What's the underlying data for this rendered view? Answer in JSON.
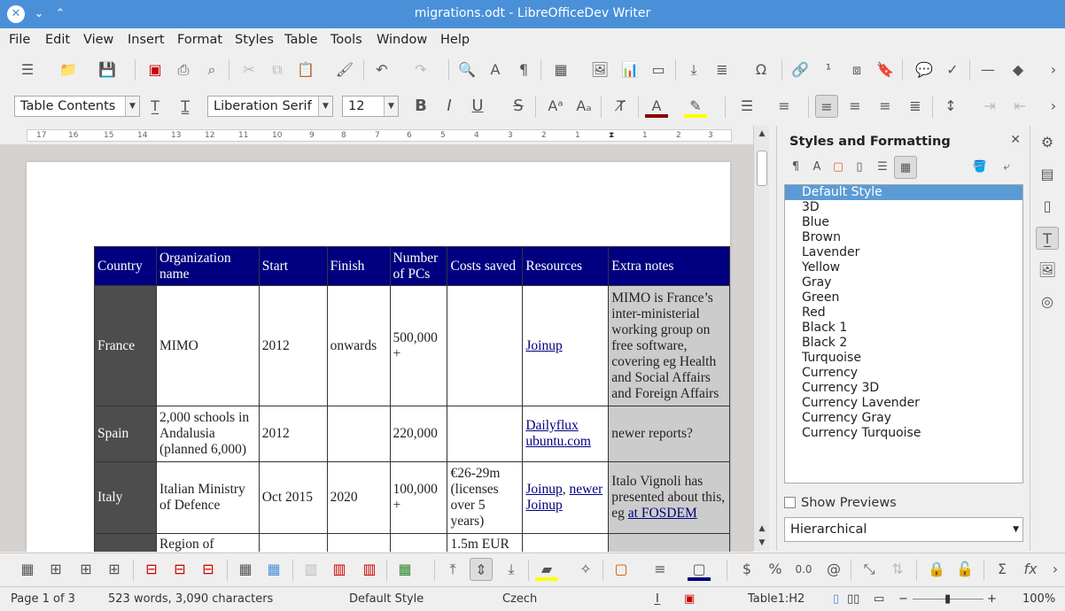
{
  "window": {
    "title": "migrations.odt - LibreOfficeDev Writer"
  },
  "menu": [
    "File",
    "Edit",
    "View",
    "Insert",
    "Format",
    "Styles",
    "Table",
    "Tools",
    "Window",
    "Help"
  ],
  "formatting": {
    "paragraph_style": "Table Contents",
    "font_name": "Liberation Serif",
    "font_size": "12"
  },
  "table": {
    "headers": [
      "Country",
      "Organization name",
      "Start",
      "Finish",
      "Number of PCs",
      "Costs saved",
      "Resources",
      "Extra notes"
    ],
    "rows": [
      {
        "country": "France",
        "org": "MIMO",
        "start": "2012",
        "finish": "onwards",
        "pcs": "500,000 +",
        "costs": "",
        "resources": [
          "Joinup"
        ],
        "notes": "MIMO is France’s inter-ministerial working group on free software, covering eg Health and Social Affairs and Foreign Affairs"
      },
      {
        "country": "Spain",
        "org": "2,000 schools in Andalusia (planned 6,000)",
        "start": "2012",
        "finish": "",
        "pcs": "220,000",
        "costs": "",
        "resources": [
          "Dailyflux",
          "ubuntu.com"
        ],
        "notes": "newer reports?"
      },
      {
        "country": "Italy",
        "org": "Italian Ministry of Defence",
        "start": "Oct 2015",
        "finish": "2020",
        "pcs": "100,000 +",
        "costs": "€26-29m (licenses over 5 years)",
        "resources": [
          "Joinup",
          "newer Joinup"
        ],
        "notes_prefix": "Italo Vignoli has presented about this, eg ",
        "notes_link": "at FOSDEM"
      },
      {
        "country": "",
        "org": "Region of",
        "start": "",
        "finish": "",
        "pcs": "",
        "costs": "1.5m EUR",
        "resources": [],
        "notes": ""
      }
    ]
  },
  "sidebar": {
    "title": "Styles and Formatting",
    "styles": [
      "Default Style",
      "3D",
      "Blue",
      "Brown",
      "Lavender",
      "Yellow",
      "Gray",
      "Green",
      "Red",
      "Black 1",
      "Black 2",
      "Turquoise",
      "Currency",
      "Currency 3D",
      "Currency Lavender",
      "Currency Gray",
      "Currency Turquoise"
    ],
    "selected_style": "Default Style",
    "show_previews_label": "Show Previews",
    "filter": "Hierarchical"
  },
  "ruler_labels": [
    "17",
    "16",
    "15",
    "14",
    "13",
    "12",
    "11",
    "10",
    "9",
    "8",
    "7",
    "6",
    "5",
    "4",
    "3",
    "2",
    "1",
    "1",
    "2",
    "3"
  ],
  "status": {
    "page": "Page 1 of 3",
    "words": "523 words, 3,090 characters",
    "style": "Default Style",
    "language": "Czech",
    "table_cell": "Table1:H2",
    "zoom": "100%"
  },
  "colors": {
    "titlebar": "#4a90d9",
    "table_header": "#000080",
    "country_col": "#4d4d4d",
    "notes_col": "#cccccc",
    "selection": "#5b9bd5"
  }
}
